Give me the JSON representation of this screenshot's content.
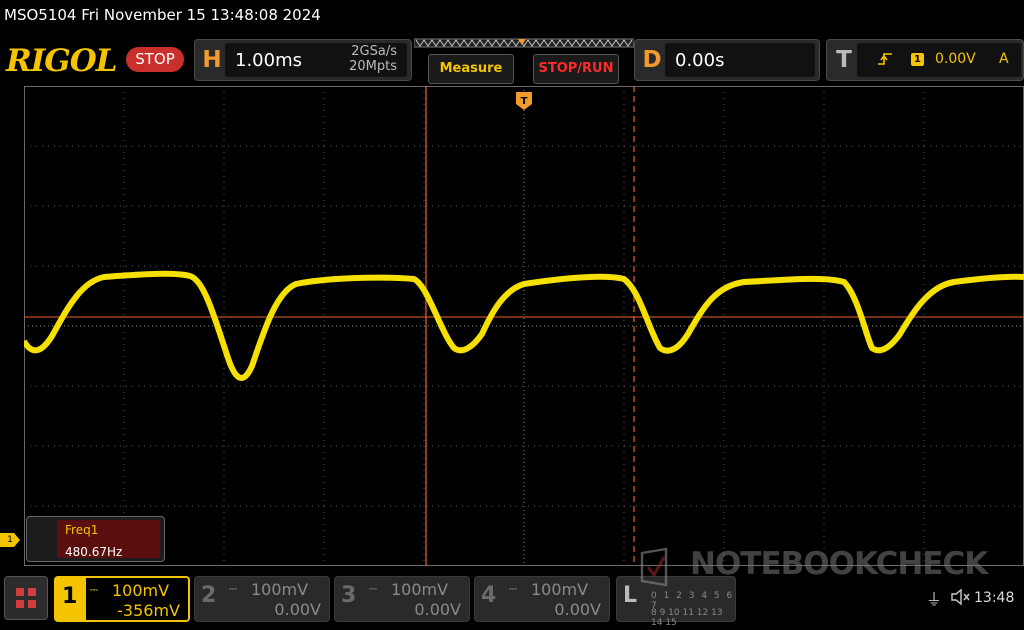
{
  "window": {
    "title": "MSO5104  Fri November 15 13:48:08 2024"
  },
  "header": {
    "brand": "RIGOL",
    "run_state": "STOP",
    "horizontal": {
      "letter": "H",
      "timebase": "1.00ms",
      "sample_rate": "2GSa/s",
      "memory_depth": "20Mpts"
    },
    "measure_button": "Measure",
    "stop_run_button": "STOP/RUN",
    "delay": {
      "letter": "D",
      "value": "0.00s"
    },
    "trigger": {
      "letter": "T",
      "source": "1",
      "level": "0.00V",
      "mode": "A"
    }
  },
  "display": {
    "trace_color": "#f5e000",
    "cursor_color": "#e8622a",
    "ch1_marker": "1"
  },
  "measurement": {
    "name": "Freq1",
    "value": "480.67Hz"
  },
  "channels": [
    {
      "num": "1",
      "coupling": "DC",
      "scale": "100mV",
      "offset": "-356mV",
      "active": true
    },
    {
      "num": "2",
      "coupling": "DC",
      "scale": "100mV",
      "offset": "0.00V",
      "active": false
    },
    {
      "num": "3",
      "coupling": "DC",
      "scale": "100mV",
      "offset": "0.00V",
      "active": false
    },
    {
      "num": "4",
      "coupling": "DC",
      "scale": "100mV",
      "offset": "0.00V",
      "active": false
    }
  ],
  "logic": {
    "letter": "L",
    "row1": "0 1 2 3 4 5 6 7",
    "row2": "8 9 10 11 12 13 14 15"
  },
  "watermark": "NOTEBOOKCHECK",
  "status": {
    "time": "13:48"
  }
}
